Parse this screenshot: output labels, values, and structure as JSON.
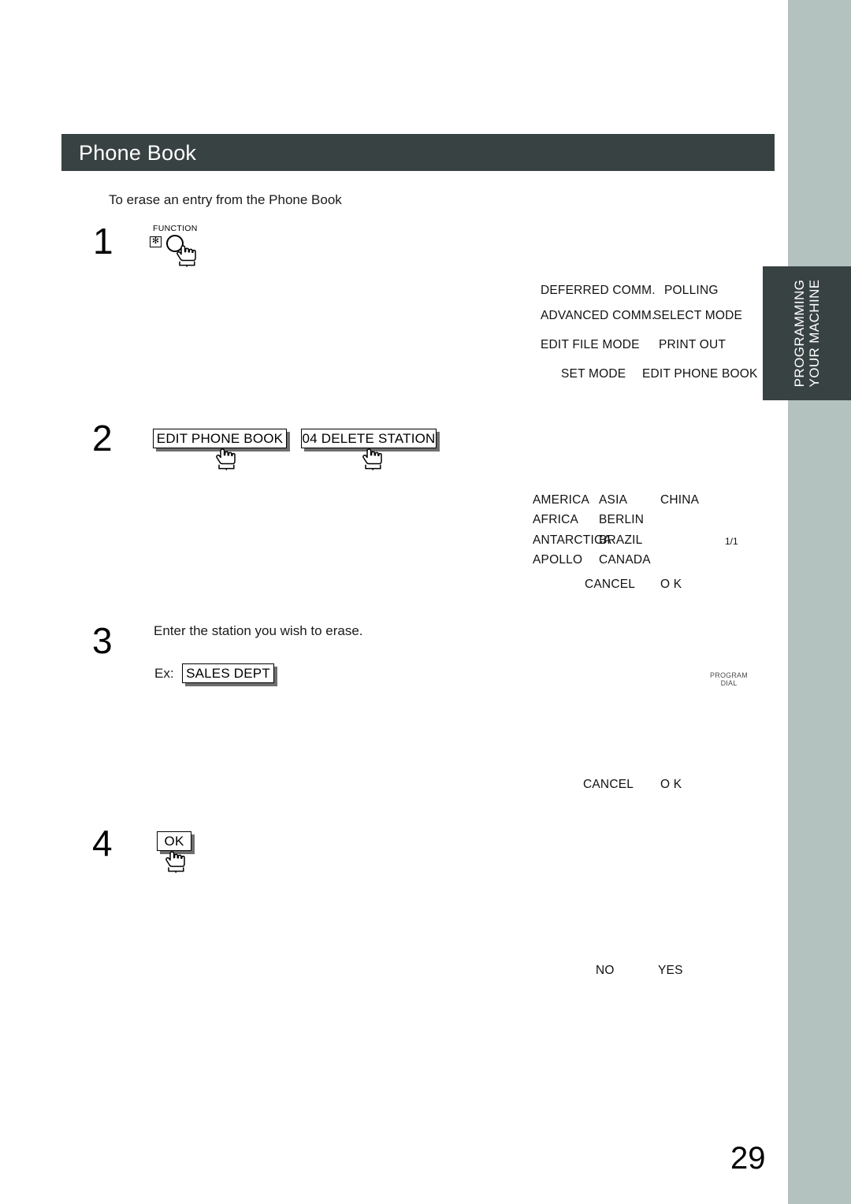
{
  "page": {
    "number": "29",
    "section_tab": {
      "line1": "PROGRAMMING",
      "line2": "YOUR MACHINE"
    }
  },
  "header": {
    "title": "Phone Book"
  },
  "intro": {
    "text": "To erase an entry from the Phone Book"
  },
  "steps": [
    {
      "number": "1",
      "key": {
        "label": "FUNCTION",
        "asterisk_glyph": "✻",
        "icon": "function-key"
      }
    },
    {
      "number": "2",
      "buttons": [
        {
          "label": "EDIT PHONE BOOK"
        },
        {
          "label": "04 DELETE STATION"
        }
      ]
    },
    {
      "number": "3",
      "text": "Enter the station you wish to erase.",
      "example_prefix": "Ex:",
      "example_button": "SALES DEPT"
    },
    {
      "number": "4",
      "button": "OK"
    }
  ],
  "lcd_function_menu": {
    "rows": [
      {
        "left": "DEFERRED COMM.",
        "right": "POLLING"
      },
      {
        "left": "ADVANCED COMM.",
        "right": "SELECT MODE"
      },
      {
        "left": "EDIT FILE MODE",
        "right": "PRINT OUT"
      },
      {
        "left": "SET MODE",
        "right": "EDIT PHONE BOOK"
      }
    ]
  },
  "lcd_station_list": {
    "columns": [
      [
        "AMERICA",
        "AFRICA",
        "ANTARCTICA",
        "APOLLO"
      ],
      [
        "ASIA",
        "BERLIN",
        "BRAZIL",
        "CANADA"
      ],
      [
        "CHINA",
        "",
        "",
        ""
      ]
    ],
    "page_indicator": "1/1",
    "softkeys": {
      "cancel": "CANCEL",
      "ok": "O K"
    }
  },
  "lcd_entry_screen": {
    "program_dial_label_line1": "PROGRAM",
    "program_dial_label_line2": "DIAL",
    "softkeys": {
      "cancel": "CANCEL",
      "ok": "O K"
    }
  },
  "lcd_confirm_screen": {
    "softkeys": {
      "no": "NO",
      "yes": "YES"
    }
  }
}
